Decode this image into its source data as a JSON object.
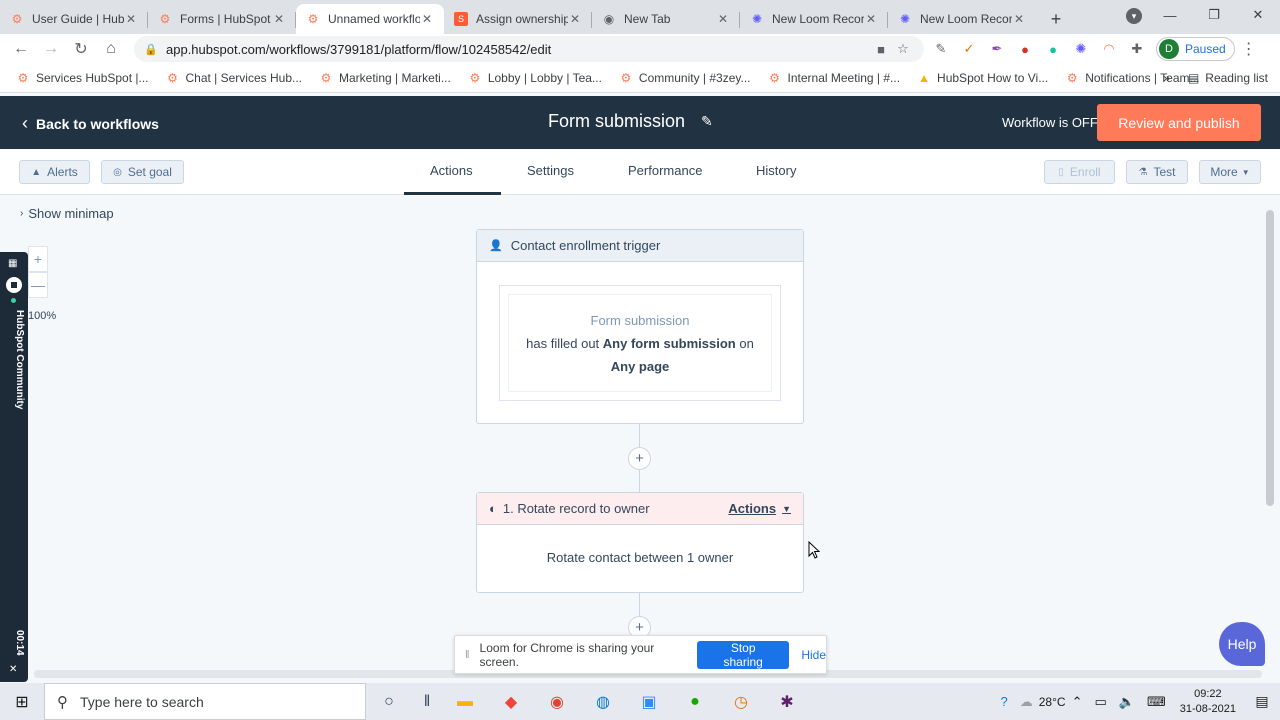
{
  "browser": {
    "tabs": [
      {
        "title": "User Guide | HubSpot",
        "icon": "hubspot-icon",
        "color": "#ff7a59",
        "active": false
      },
      {
        "title": "Forms | HubSpot",
        "icon": "hubspot-icon",
        "color": "#ff7a59",
        "active": false
      },
      {
        "title": "Unnamed workflow",
        "icon": "hubspot-icon",
        "color": "#ff7a59",
        "active": true
      },
      {
        "title": "Assign ownership",
        "icon": "hubspot-icon",
        "color": "#ff5c35",
        "active": false
      },
      {
        "title": "New Tab",
        "icon": "chrome-icon",
        "color": "#5f6368",
        "active": false
      },
      {
        "title": "New Loom Recording",
        "icon": "loom-icon",
        "color": "#625df5",
        "active": false
      },
      {
        "title": "New Loom Recording",
        "icon": "loom-icon",
        "color": "#625df5",
        "active": false
      }
    ],
    "url": "app.hubspot.com/workflows/3799181/platform/flow/102458542/edit",
    "profile_initial": "D",
    "profile_status": "Paused",
    "bookmarks": [
      "Services HubSpot |...",
      "Chat | Services Hub...",
      "Marketing | Marketi...",
      "Lobby | Lobby | Tea...",
      "Community | #3zey...",
      "Internal Meeting | #...",
      "HubSpot How to Vi...",
      "Notifications | Team..."
    ],
    "bookmarks_more": "»",
    "reading_list": "Reading list"
  },
  "header": {
    "back_label": "Back to workflows",
    "workflow_title": "Form submission",
    "workflow_status": "Workflow is OFF",
    "publish_label": "Review and publish",
    "accent_color": "#ff7a59"
  },
  "subbar": {
    "alerts_label": "Alerts",
    "set_goal_label": "Set goal",
    "tabs": [
      "Actions",
      "Settings",
      "Performance",
      "History"
    ],
    "active_tab": "Actions",
    "enroll_label": "Enroll",
    "test_label": "Test",
    "more_label": "More"
  },
  "canvas": {
    "minimap_label": "Show minimap",
    "zoom_plus": "+",
    "zoom_minus": "—",
    "zoom_level": "100%",
    "trigger": {
      "header": "Contact enrollment trigger",
      "filter_type": "Form submission",
      "line1_pre": "has filled out",
      "line1_bold": "Any form submission",
      "line1_post": "on",
      "line2_bold": "Any page"
    },
    "action": {
      "header": "1. Rotate record to owner",
      "actions_label": "Actions",
      "body": "Rotate contact between 1 owner"
    },
    "help_label": "Help"
  },
  "loom": {
    "banner_message": "Loom for Chrome is sharing your screen.",
    "stop_label": "Stop sharing",
    "hide_label": "Hide",
    "side_label": "HubSpot Community",
    "timer": "00:14"
  },
  "taskbar": {
    "search_placeholder": "Type here to search",
    "temperature": "28°C",
    "time": "09:22",
    "date": "31-08-2021"
  }
}
